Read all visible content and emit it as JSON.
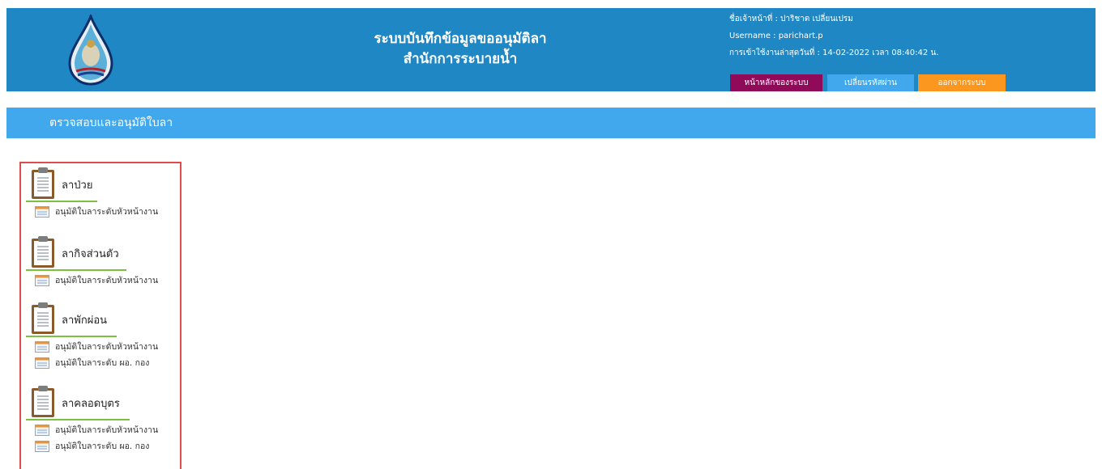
{
  "header": {
    "title_line1": "ระบบบันทึกข้อมูลขออนุมัติลา",
    "title_line2": "สำนักการระบายน้ำ",
    "officer": "ชื่อเจ้าหน้าที่ : ปาริชาต เปลี่ยนเปรม",
    "username": "Username : parichart.p",
    "last_login": "การเข้าใช้งานล่าสุดวันที่ : 14-02-2022 เวลา 08:40:42 น.",
    "buttons": {
      "home": "หน้าหลักของระบบ",
      "change_password": "เปลี่ยนรหัสผ่าน",
      "logout": "ออกจากระบบ"
    }
  },
  "page": {
    "title": "ตรวจสอบและอนุมัติใบลา"
  },
  "menu": [
    {
      "label": "ลาป่วย",
      "items": [
        "อนุมัติใบลาระดับหัวหน้างาน"
      ]
    },
    {
      "label": "ลากิจส่วนตัว",
      "items": [
        "อนุมัติใบลาระดับหัวหน้างาน"
      ]
    },
    {
      "label": "ลาพักผ่อน",
      "items": [
        "อนุมัติใบลาระดับหัวหน้างาน",
        "อนุมัติใบลาระดับ ผอ. กอง"
      ]
    },
    {
      "label": "ลาคลอดบุตร",
      "items": [
        "อนุมัติใบลาระดับหัวหน้างาน",
        "อนุมัติใบลาระดับ ผอ. กอง"
      ]
    }
  ],
  "colors": {
    "header_bg": "#1f87c4",
    "pagebar_bg": "#42a8ee",
    "home_btn": "#8f0b5a",
    "password_btn": "#42a8ee",
    "logout_btn": "#fb961f",
    "menu_border": "#e34a4a",
    "underline": "#7bc040"
  },
  "icons": {
    "logo": "water-drop-logo-icon",
    "category": "clipboard-icon",
    "item": "document-icon"
  }
}
